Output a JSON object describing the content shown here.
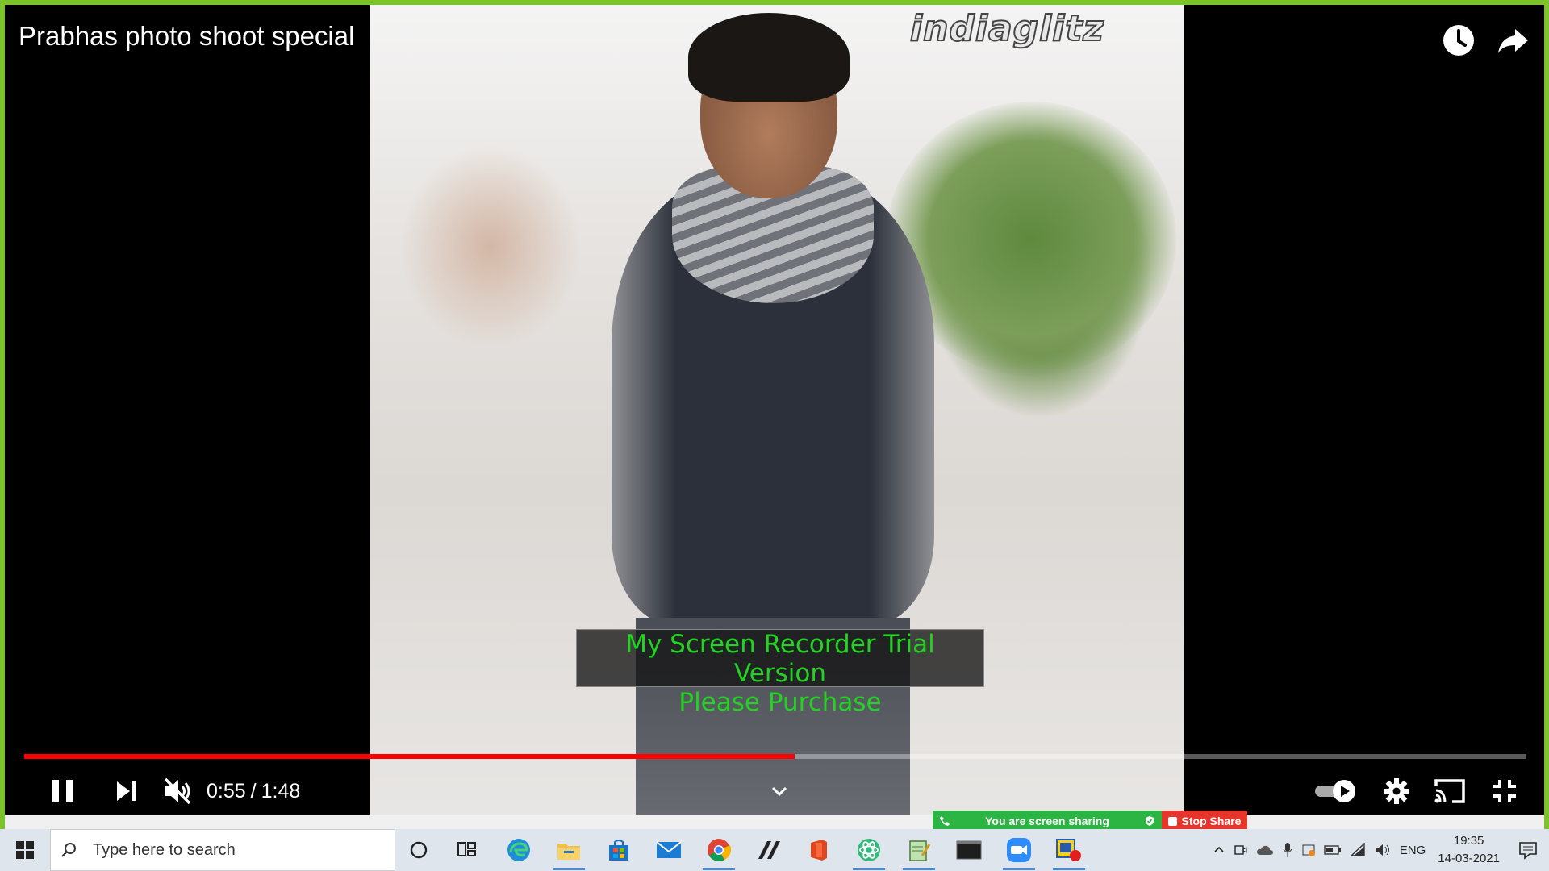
{
  "video": {
    "title": "Prabhas photo shoot special",
    "watermark_logo": "indiaglitz",
    "recorder_overlay": {
      "line1": "My Screen Recorder Trial Version",
      "line2": "Please Purchase"
    },
    "current_time": "0:55",
    "separator": "/",
    "duration": "1:48",
    "progress_fraction": 0.513,
    "top_icons": [
      "watch-later-icon",
      "share-icon"
    ],
    "control_icons": [
      "pause-icon",
      "next-icon",
      "muted-volume-icon",
      "chevron-down-icon",
      "autoplay-toggle-icon",
      "settings-icon",
      "cast-icon",
      "exit-fullscreen-icon"
    ],
    "progress_color": "#ff0000"
  },
  "zoom_bar": {
    "status": "You are screen sharing",
    "stop_label": "Stop Share",
    "status_color": "#2db543",
    "stop_color": "#e7352c"
  },
  "taskbar": {
    "search_placeholder": "Type here to search",
    "apps": [
      "windows-start-icon",
      "cortana-icon",
      "task-view-icon",
      "edge-icon",
      "file-explorer-icon",
      "store-icon",
      "mail-icon",
      "chrome-icon",
      "app-slash-icon",
      "office-icon",
      "atom-icon",
      "notepad-icon",
      "terminal-icon",
      "zoom-icon",
      "recorder-icon"
    ],
    "language": "ENG",
    "time": "19:35",
    "date": "14-03-2021"
  }
}
